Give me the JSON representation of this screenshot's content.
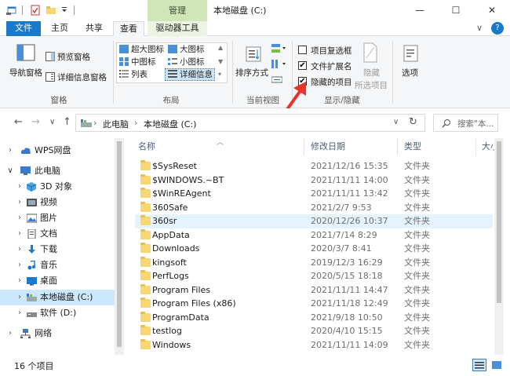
{
  "window": {
    "context_tab_header": "管理",
    "title": "本地磁盘 (C:)",
    "minimize": "—",
    "maximize": "☐",
    "close": "✕",
    "help": "?",
    "collapse": "∨"
  },
  "tabs": [
    {
      "label": "文件"
    },
    {
      "label": "主页"
    },
    {
      "label": "共享"
    },
    {
      "label": "查看"
    },
    {
      "label": "驱动器工具"
    }
  ],
  "ribbon": {
    "panes": {
      "nav_pane": "导航窗格",
      "preview_pane": "预览窗格",
      "details_pane": "详细信息窗格",
      "label": "窗格"
    },
    "layout": {
      "extra_large": "超大图标",
      "large": "大图标",
      "medium": "中图标",
      "small": "小图标",
      "list": "列表",
      "details": "详细信息",
      "label": "布局"
    },
    "current_view": {
      "sort_by": "排序方式",
      "label": "当前视图"
    },
    "show_hide": {
      "item_checkboxes": "项目复选框",
      "file_extensions": "文件扩展名",
      "hidden_items": "隐藏的项目",
      "hide_selected_top": "隐藏",
      "hide_selected_bottom": "所选项目",
      "item_checkboxes_checked": false,
      "file_extensions_checked": true,
      "hidden_items_checked": true,
      "label": "显示/隐藏"
    },
    "options": "选项"
  },
  "address": {
    "back": "←",
    "forward": "→",
    "dropdown": "∨",
    "up": "↑",
    "crumb_this_pc": "此电脑",
    "crumb_drive": "本地磁盘 (C:)",
    "sep": "›",
    "refresh": "↻",
    "search_placeholder": "搜索\"本..."
  },
  "nav": {
    "items": [
      {
        "label": "WPS网盘",
        "arrow": "›"
      },
      {
        "label": "此电脑",
        "arrow": "∨"
      },
      {
        "label": "3D 对象",
        "arrow": "›"
      },
      {
        "label": "视频",
        "arrow": "›"
      },
      {
        "label": "图片",
        "arrow": "›"
      },
      {
        "label": "文档",
        "arrow": "›"
      },
      {
        "label": "下载",
        "arrow": "›"
      },
      {
        "label": "音乐",
        "arrow": "›"
      },
      {
        "label": "桌面",
        "arrow": "›"
      },
      {
        "label": "本地磁盘 (C:)",
        "arrow": "›"
      },
      {
        "label": "软件 (D:)",
        "arrow": "›"
      },
      {
        "label": "网络",
        "arrow": "›"
      }
    ]
  },
  "columns": {
    "name": "名称",
    "date": "修改日期",
    "type": "类型",
    "size": "大小"
  },
  "files": [
    {
      "name": "$SysReset",
      "date": "2021/12/16 15:35",
      "type": "文件夹"
    },
    {
      "name": "$WINDOWS.~BT",
      "date": "2021/11/11 14:00",
      "type": "文件夹"
    },
    {
      "name": "$WinREAgent",
      "date": "2021/11/11 13:42",
      "type": "文件夹"
    },
    {
      "name": "360Safe",
      "date": "2021/2/7 9:53",
      "type": "文件夹"
    },
    {
      "name": "360sr",
      "date": "2020/12/26 10:37",
      "type": "文件夹"
    },
    {
      "name": "AppData",
      "date": "2021/7/14 8:29",
      "type": "文件夹"
    },
    {
      "name": "Downloads",
      "date": "2020/3/7 8:41",
      "type": "文件夹"
    },
    {
      "name": "kingsoft",
      "date": "2019/12/3 16:29",
      "type": "文件夹"
    },
    {
      "name": "PerfLogs",
      "date": "2020/5/15 18:18",
      "type": "文件夹"
    },
    {
      "name": "Program Files",
      "date": "2021/11/11 14:47",
      "type": "文件夹"
    },
    {
      "name": "Program Files (x86)",
      "date": "2021/11/18 12:49",
      "type": "文件夹"
    },
    {
      "name": "ProgramData",
      "date": "2021/9/18 10:50",
      "type": "文件夹"
    },
    {
      "name": "testlog",
      "date": "2020/4/10 15:15",
      "type": "文件夹"
    },
    {
      "name": "Windows",
      "date": "2021/11/11 14:09",
      "type": "文件夹"
    }
  ],
  "status": {
    "item_count": "16 个项目"
  },
  "colors": {
    "accent": "#1979ca",
    "context_tab": "#cfe7b8",
    "arrow_annotation": "#e8322a",
    "selection": "#cce8ff"
  }
}
